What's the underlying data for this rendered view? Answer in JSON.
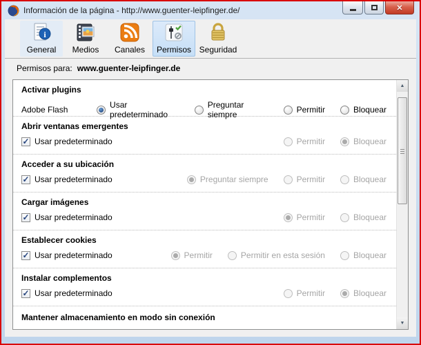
{
  "window": {
    "title": "Información de la página - http://www.guenter-leipfinger.de/",
    "controls": {
      "minimize": "minimize",
      "maximize": "maximize",
      "close": "✕"
    }
  },
  "tabs": [
    {
      "id": "general",
      "label": "General",
      "selected": false
    },
    {
      "id": "medios",
      "label": "Medios",
      "selected": false
    },
    {
      "id": "canales",
      "label": "Canales",
      "selected": false
    },
    {
      "id": "permisos",
      "label": "Permisos",
      "selected": true
    },
    {
      "id": "seguridad",
      "label": "Seguridad",
      "selected": false
    }
  ],
  "permissions_for": {
    "label": "Permisos para:",
    "domain": "www.guenter-leipfinger.de"
  },
  "sections": [
    {
      "title": "Activar plugins",
      "row_label": "Adobe Flash",
      "options": [
        {
          "label": "Usar predeterminado",
          "selected": true,
          "disabled": false
        },
        {
          "label": "Preguntar siempre",
          "selected": false,
          "disabled": false
        },
        {
          "label": "Permitir",
          "selected": false,
          "disabled": false
        },
        {
          "label": "Bloquear",
          "selected": false,
          "disabled": false
        }
      ]
    },
    {
      "title": "Abrir ventanas emergentes",
      "checkbox": {
        "label": "Usar predeterminado",
        "checked": true
      },
      "options": [
        {
          "label": "Permitir",
          "selected": false,
          "disabled": true
        },
        {
          "label": "Bloquear",
          "selected": true,
          "disabled": true
        }
      ]
    },
    {
      "title": "Acceder a su ubicación",
      "checkbox": {
        "label": "Usar predeterminado",
        "checked": true
      },
      "options": [
        {
          "label": "Preguntar siempre",
          "selected": true,
          "disabled": true
        },
        {
          "label": "Permitir",
          "selected": false,
          "disabled": true
        },
        {
          "label": "Bloquear",
          "selected": false,
          "disabled": true
        }
      ]
    },
    {
      "title": "Cargar imágenes",
      "checkbox": {
        "label": "Usar predeterminado",
        "checked": true
      },
      "options": [
        {
          "label": "Permitir",
          "selected": true,
          "disabled": true
        },
        {
          "label": "Bloquear",
          "selected": false,
          "disabled": true
        }
      ]
    },
    {
      "title": "Establecer cookies",
      "checkbox": {
        "label": "Usar predeterminado",
        "checked": true
      },
      "options": [
        {
          "label": "Permitir",
          "selected": true,
          "disabled": true
        },
        {
          "label": "Permitir en esta sesión",
          "selected": false,
          "disabled": true
        },
        {
          "label": "Bloquear",
          "selected": false,
          "disabled": true
        }
      ]
    },
    {
      "title": "Instalar complementos",
      "checkbox": {
        "label": "Usar predeterminado",
        "checked": true
      },
      "options": [
        {
          "label": "Permitir",
          "selected": false,
          "disabled": true
        },
        {
          "label": "Bloquear",
          "selected": true,
          "disabled": true
        }
      ]
    },
    {
      "title": "Mantener almacenamiento en modo sin conexión",
      "partial": true
    }
  ],
  "colors": {
    "annotation_border": "#d90000",
    "titlebar": "#c9dcf0",
    "selected_tab": "#c6dff7",
    "close_button": "#c13a24",
    "radio_selected_dot": "#17356b",
    "disabled_text": "#a5a5a5"
  },
  "checkmark": "✓"
}
